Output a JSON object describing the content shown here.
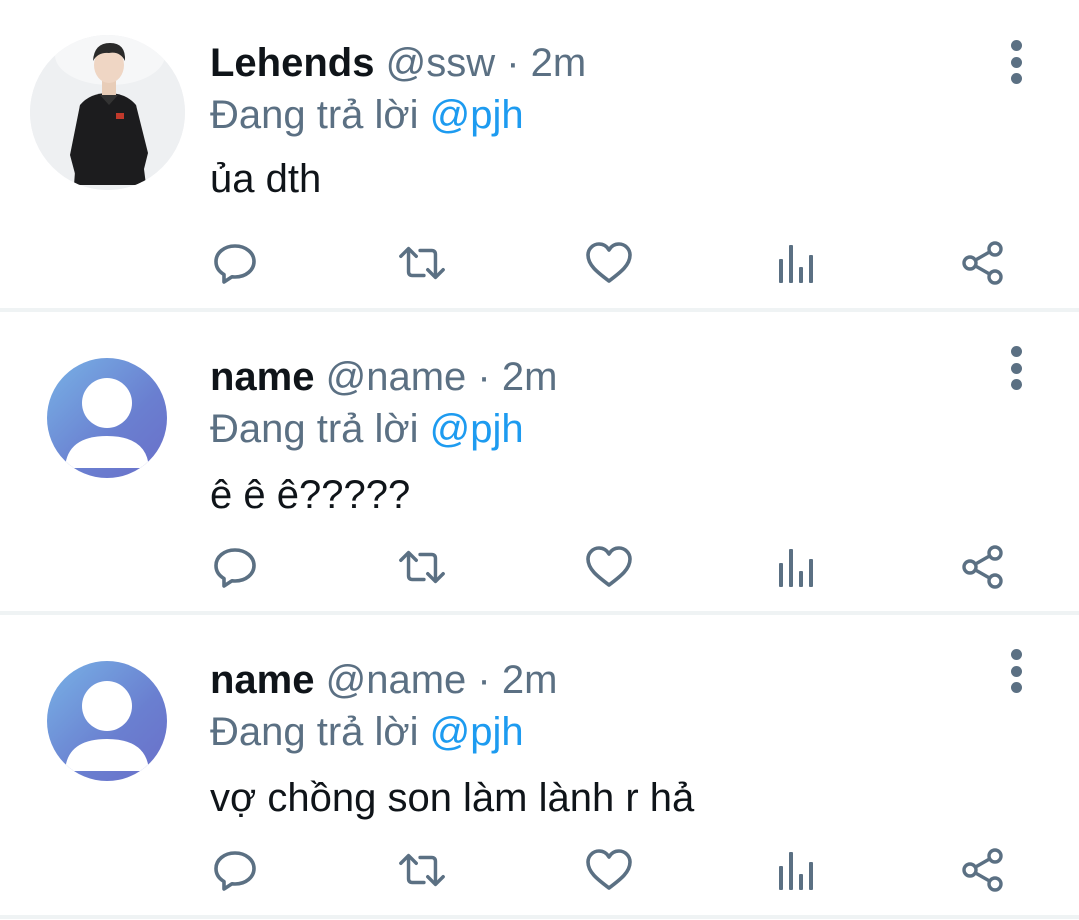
{
  "feed": {
    "tweets": [
      {
        "name": "Lehends",
        "handle": "@ssw",
        "time": "· 2m",
        "reply_prefix": "Đang trả lời",
        "reply_to": "@pjh",
        "text": "ủa dth",
        "avatar": "profile-photo"
      },
      {
        "name": "name",
        "handle": "@name",
        "time": "· 2m",
        "reply_prefix": "Đang trả lời",
        "reply_to": "@pjh",
        "text": "ê ê ê?????",
        "avatar": "default-avatar"
      },
      {
        "name": "name",
        "handle": "@name",
        "time": "· 2m",
        "reply_prefix": "Đang trả lời",
        "reply_to": "@pjh",
        "text": "vợ chồng son làm lành r hả",
        "avatar": "default-avatar"
      }
    ]
  },
  "icons": {
    "reply": "reply-icon",
    "retweet": "retweet-icon",
    "like": "heart-icon",
    "stats": "analytics-icon",
    "share": "share-icon",
    "more": "more-vertical-icon"
  },
  "colors": {
    "text": "#0f1419",
    "secondary": "#5b7083",
    "mention": "#1d9bf0",
    "divider": "#eff3f4"
  }
}
